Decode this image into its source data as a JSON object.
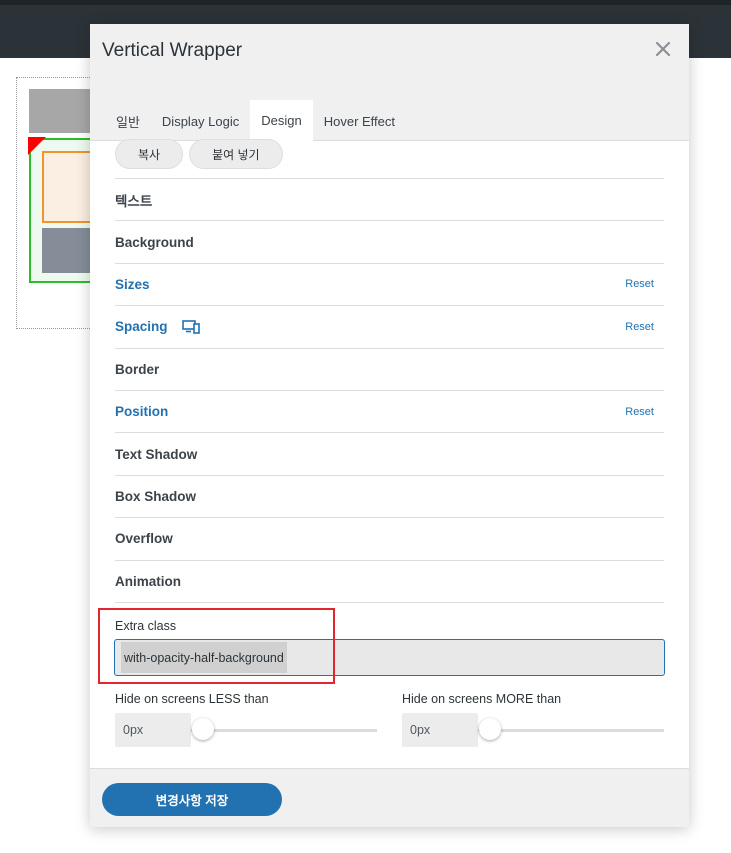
{
  "dialog": {
    "title": "Vertical Wrapper",
    "close_icon": "close-icon"
  },
  "tabs": [
    {
      "label": "일반",
      "active": false
    },
    {
      "label": "Display Logic",
      "active": false
    },
    {
      "label": "Design",
      "active": true
    },
    {
      "label": "Hover Effect",
      "active": false
    }
  ],
  "actions": {
    "copy_label": "복사",
    "paste_label": "붙여 넣기"
  },
  "sections": [
    {
      "label": "텍스트",
      "highlighted": false,
      "reset": ""
    },
    {
      "label": "Background",
      "highlighted": false,
      "reset": ""
    },
    {
      "label": "Sizes",
      "highlighted": true,
      "reset": "Reset"
    },
    {
      "label": "Spacing",
      "highlighted": true,
      "reset": "Reset",
      "icon": "responsive-devices-icon"
    },
    {
      "label": "Border",
      "highlighted": false,
      "reset": ""
    },
    {
      "label": "Position",
      "highlighted": true,
      "reset": "Reset"
    },
    {
      "label": "Text Shadow",
      "highlighted": false,
      "reset": ""
    },
    {
      "label": "Box Shadow",
      "highlighted": false,
      "reset": ""
    },
    {
      "label": "Overflow",
      "highlighted": false,
      "reset": ""
    },
    {
      "label": "Animation",
      "highlighted": false,
      "reset": ""
    }
  ],
  "extra_class": {
    "label": "Extra class",
    "value": "with-opacity-half-background"
  },
  "hide_less": {
    "label": "Hide on screens LESS than",
    "value": "0px",
    "slider_fraction": 0
  },
  "hide_more": {
    "label": "Hide on screens MORE than",
    "value": "0px",
    "slider_fraction": 0
  },
  "footer": {
    "save_label": "변경사항 저장"
  },
  "colors": {
    "accent": "#2271b1",
    "highlight_box": "#e3262e",
    "topbar": "#2c3338"
  }
}
